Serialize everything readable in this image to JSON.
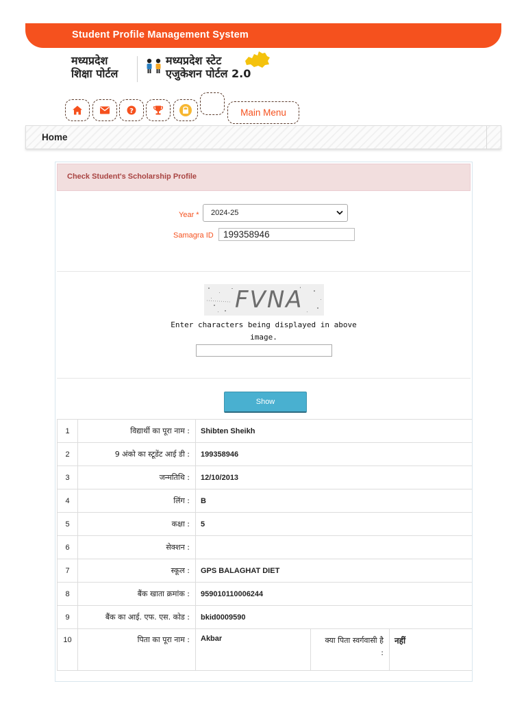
{
  "header": {
    "title": "Student Profile Management System",
    "logo_left_line1": "मध्यप्रदेश",
    "logo_left_line2": "शिक्षा पोर्टल",
    "logo_right_line1": "मध्यप्रदेश स्टेट",
    "logo_right_line2": "एजुकेशन पोर्टल 2.0"
  },
  "toolbar": {
    "icons": [
      "home-icon",
      "envelope-icon",
      "question-icon",
      "trophy-icon",
      "lock-icon"
    ],
    "main_menu_label": "Main Menu"
  },
  "breadcrumb": {
    "home": "Home"
  },
  "form": {
    "heading": "Check Student's Scholarship Profile",
    "year_label": "Year",
    "year_required_mark": "*",
    "year_value": "2024-25",
    "samagra_label": "Samagra ID",
    "samagra_value": "199358946",
    "captcha_text": "FVNA",
    "captcha_instruction_line1": "Enter characters being displayed in above",
    "captcha_instruction_line2": "image.",
    "show_button": "Show"
  },
  "details": {
    "rows": [
      {
        "no": "1",
        "label": "विद्यार्थी का पूरा नाम :",
        "value": "Shibten Sheikh"
      },
      {
        "no": "2",
        "label": "9 अंको का स्टूडेंट आई डी :",
        "value": "199358946"
      },
      {
        "no": "3",
        "label": "जन्मतिथि :",
        "value": "12/10/2013"
      },
      {
        "no": "4",
        "label": "लिंग :",
        "value": "B"
      },
      {
        "no": "5",
        "label": "कक्षा :",
        "value": "5"
      },
      {
        "no": "6",
        "label": "सेक्शन :",
        "value": ""
      },
      {
        "no": "7",
        "label": "स्कूल :",
        "value": "GPS BALAGHAT DIET"
      },
      {
        "no": "8",
        "label": "बैंक खाता क्रमांक :",
        "value": "959010110006244"
      },
      {
        "no": "9",
        "label": "बैंक का आई. एफ. एस. कोड :",
        "value": "bkid0009590"
      }
    ],
    "row10": {
      "no": "10",
      "label": "पिता का पूरा नाम :",
      "value": "Akbar",
      "extra_label_line1": "क्या पिता स्वर्गवासी है",
      "extra_label_line2": ":",
      "extra_value": "नहीं"
    }
  },
  "colors": {
    "brand": "#f5511e",
    "button": "#49b0d0",
    "alert_bg": "#f2dede",
    "alert_text": "#a94442"
  }
}
